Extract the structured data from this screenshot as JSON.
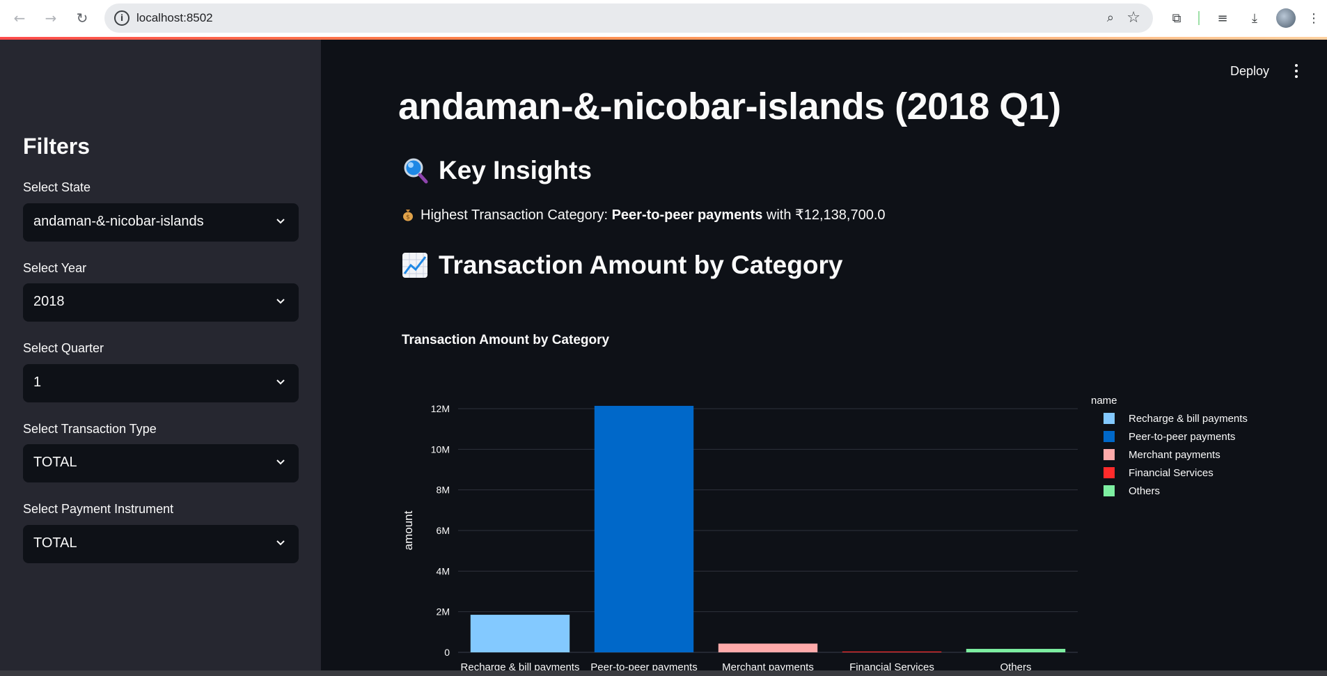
{
  "browser": {
    "url": "localhost:8502",
    "back_icon": "arrow-left-icon",
    "forward_icon": "arrow-right-icon",
    "reload_icon": "reload-icon"
  },
  "app": {
    "deploy_label": "Deploy",
    "title": "andaman-&-nicobar-islands (2018 Q1)"
  },
  "sidebar": {
    "heading": "Filters",
    "filters": [
      {
        "label": "Select State",
        "value": "andaman-&-nicobar-islands"
      },
      {
        "label": "Select Year",
        "value": "2018"
      },
      {
        "label": "Select Quarter",
        "value": "1"
      },
      {
        "label": "Select Transaction Type",
        "value": "TOTAL"
      },
      {
        "label": "Select Payment Instrument",
        "value": "TOTAL"
      }
    ]
  },
  "insights": {
    "heading": "Key Insights",
    "prefix": "Highest Transaction Category: ",
    "category": "Peer-to-peer payments",
    "suffix": " with ₹12,138,700.0"
  },
  "section2": {
    "heading": "Transaction Amount by Category"
  },
  "chart_data": {
    "type": "bar",
    "title": "Transaction Amount by Category",
    "xlabel": "",
    "ylabel": "amount",
    "categories": [
      "Recharge & bill payments",
      "Peer-to-peer payments",
      "Merchant payments",
      "Financial Services",
      "Others"
    ],
    "values": [
      1850000,
      12138700,
      430000,
      40000,
      170000
    ],
    "colors": [
      "#83c9ff",
      "#0068c9",
      "#ffabab",
      "#ff2b2b",
      "#7defa1"
    ],
    "ylim": [
      0,
      12000000
    ],
    "yticks": [
      0,
      2000000,
      4000000,
      6000000,
      8000000,
      10000000,
      12000000
    ],
    "ytick_labels": [
      "0",
      "2M",
      "4M",
      "6M",
      "8M",
      "10M",
      "12M"
    ],
    "legend_title": "name",
    "legend_position": "right",
    "grid": true
  }
}
